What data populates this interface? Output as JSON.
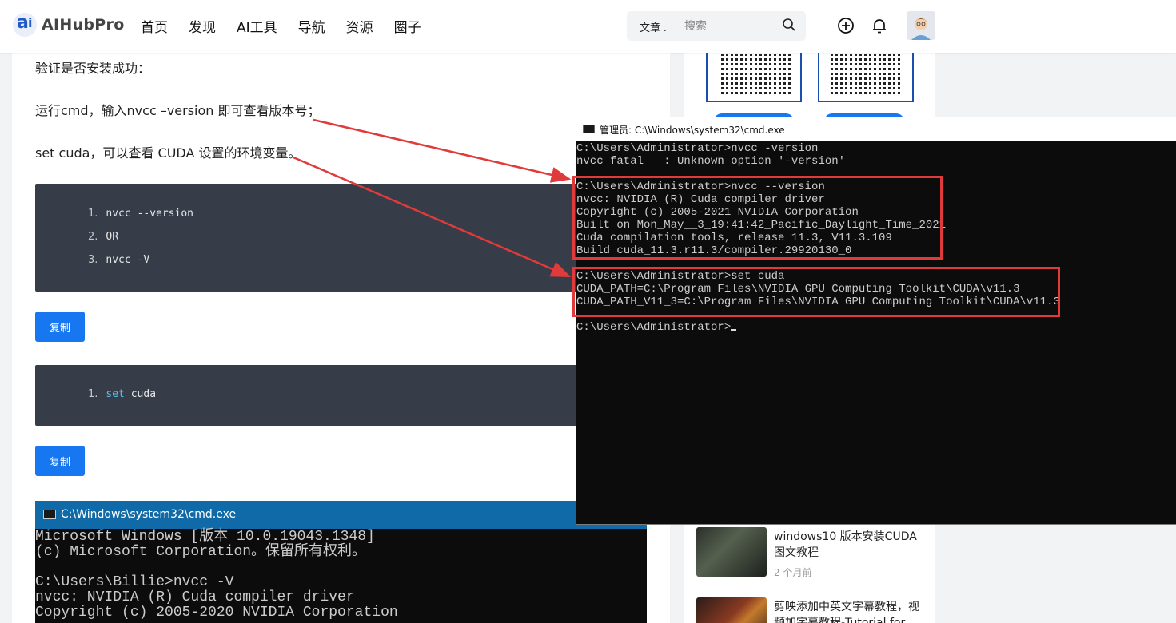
{
  "header": {
    "logo_text": "AIHubPro",
    "nav": [
      "首页",
      "发现",
      "AI工具",
      "导航",
      "资源",
      "圈子"
    ],
    "search_category": "文章",
    "search_placeholder": "搜索"
  },
  "article": {
    "verify_text": "验证是否安装成功：",
    "step1_text": "运行cmd，输入nvcc –version 即可查看版本号；",
    "step2_text": "set cuda，可以查看 CUDA 设置的环境变量。",
    "code1": [
      {
        "num": "1.",
        "code": "nvcc --version"
      },
      {
        "num": "2.",
        "code": "OR"
      },
      {
        "num": "3.",
        "code": "nvcc -V"
      }
    ],
    "copy_label": "复制",
    "code2": {
      "num": "1.",
      "keyword": "set",
      "rest": " cuda"
    }
  },
  "cmd_front": {
    "title": "管理员: C:\\Windows\\system32\\cmd.exe",
    "lines_a": [
      "C:\\Users\\Administrator>nvcc -version",
      "nvcc fatal   : Unknown option '-version'"
    ],
    "lines_b": [
      "C:\\Users\\Administrator>nvcc --version",
      "nvcc: NVIDIA (R) Cuda compiler driver",
      "Copyright (c) 2005-2021 NVIDIA Corporation",
      "Built on Mon_May__3_19:41:42_Pacific_Daylight_Time_2021",
      "Cuda compilation tools, release 11.3, V11.3.109",
      "Build cuda_11.3.r11.3/compiler.29920130_0"
    ],
    "lines_c": [
      "C:\\Users\\Administrator>set cuda",
      "CUDA_PATH=C:\\Program Files\\NVIDIA GPU Computing Toolkit\\CUDA\\v11.3",
      "CUDA_PATH_V11_3=C:\\Program Files\\NVIDIA GPU Computing Toolkit\\CUDA\\v11.3"
    ],
    "prompt": "C:\\Users\\Administrator>"
  },
  "cmd_back": {
    "title": "C:\\Windows\\system32\\cmd.exe",
    "lines": [
      "Microsoft Windows [版本 10.0.19043.1348]",
      "(c) Microsoft Corporation。保留所有权利。",
      "",
      "C:\\Users\\Billie>nvcc -V",
      "nvcc: NVIDIA (R) Cuda compiler driver",
      "Copyright (c) 2005-2020 NVIDIA Corporation"
    ]
  },
  "sidebar": {
    "posts": [
      {
        "title": "windows10 版本安装CUDA图文教程",
        "time": "2 个月前"
      },
      {
        "title": "剪映添加中英文字幕教程，视频加字幕教程-Tutorial for",
        "time": ""
      }
    ]
  },
  "colors": {
    "accent": "#1677f0",
    "annotation_red": "#e03a3a",
    "terminal_bg": "#0c0c0c",
    "code_bg": "#363d48"
  }
}
